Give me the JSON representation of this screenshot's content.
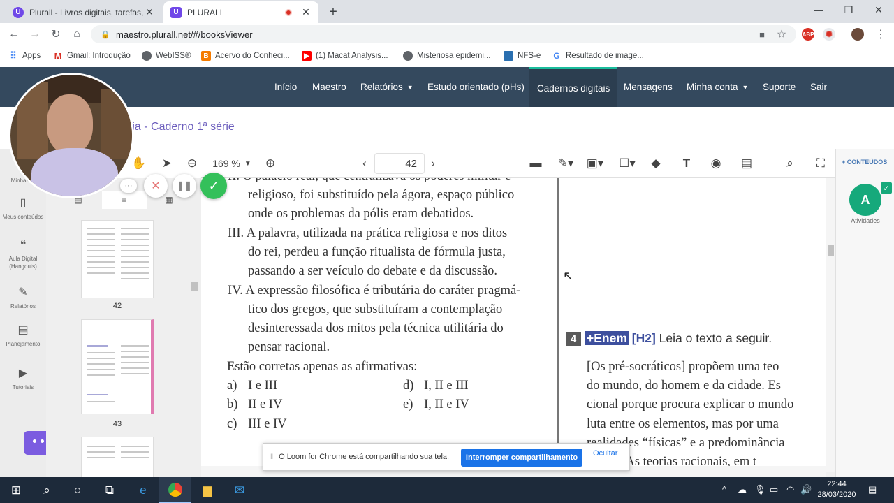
{
  "browser": {
    "tabs": [
      {
        "title": "Plurall - Livros digitais, tarefas, tu",
        "favicon": "U"
      },
      {
        "title": "PLURALL",
        "favicon": "U",
        "recording": true
      }
    ],
    "url": "maestro.plurall.net/#/booksViewer",
    "bookmarks": [
      {
        "label": "Apps"
      },
      {
        "label": "Gmail: Introdução"
      },
      {
        "label": "WebISS®"
      },
      {
        "label": "Acervo do Conheci..."
      },
      {
        "label": "(1) Macat Analysis..."
      },
      {
        "label": "Misteriosa epidemi..."
      },
      {
        "label": "NFS-e"
      },
      {
        "label": "Resultado de image..."
      }
    ]
  },
  "app_nav": {
    "items": [
      "Início",
      "Maestro",
      "Relatórios",
      "Estudo orientado (pHs)",
      "Cadernos digitais",
      "Mensagens",
      "Minha conta",
      "Suporte",
      "Sair"
    ],
    "current": "Cadernos digitais"
  },
  "book": {
    "title": "ofia - Caderno 1ª série"
  },
  "left_sidebar": {
    "items": [
      {
        "label": "Minhas tu",
        "icon": "tasks-icon"
      },
      {
        "label": "Meus conteúdos",
        "icon": "book-icon"
      },
      {
        "label": "Aula Digital (Hangouts)",
        "icon": "hangouts-icon"
      },
      {
        "label": "Relatórios",
        "icon": "report-icon"
      },
      {
        "label": "Planejamento",
        "icon": "clipboard-icon"
      },
      {
        "label": "Tutoriais",
        "icon": "play-icon"
      }
    ]
  },
  "thumbnails": [
    {
      "page": "42"
    },
    {
      "page": "43"
    }
  ],
  "viewer": {
    "zoom": "169 %",
    "page": "42"
  },
  "document": {
    "left_lines": [
      "II. O palácio real, que centralizava os poderes militar e",
      "religioso, foi substituído pela ágora, espaço público",
      "onde os problemas da pólis eram debatidos.",
      "III. A palavra, utilizada na prática religiosa e nos ditos",
      "do rei, perdeu a função ritualista de fórmula justa,",
      "passando a ser veículo do debate e da discussão.",
      "IV. A expressão filosófica é tributária do caráter pragmá-",
      "tico dos gregos, que substituíram a contemplação",
      "desinteressada dos mitos pela técnica utilitária do",
      "pensar racional."
    ],
    "prompt": "Estão corretas apenas as afirmativas:",
    "options": [
      {
        "letter": "a)",
        "text": "I e III"
      },
      {
        "letter": "b)",
        "text": "II e IV"
      },
      {
        "letter": "c)",
        "text": "III e IV"
      },
      {
        "letter": "d)",
        "text": "I, II e III"
      },
      {
        "letter": "e)",
        "text": "I, II e IV"
      }
    ],
    "question": {
      "number": "4",
      "tag": "+Enem",
      "skill": "[H2]",
      "instruction": "Leia o texto a seguir."
    },
    "right_lines": [
      "[Os pré-socráticos] propõem uma teo",
      "do mundo, do homem e da cidade. Es",
      "cional porque procura explicar o mundo",
      "luta entre os elementos, mas por uma",
      "realidades “físicas” e a predominância",
      "ns. [...] As teorias racionais, em t"
    ]
  },
  "right_panel": {
    "conteudos": "+ CONTEÚDOS",
    "activity_letter": "A",
    "activity_label": "Atividades"
  },
  "loom": {
    "message": "O Loom for Chrome está compartilhando sua tela.",
    "stop": "Interromper compartilhamento",
    "hide": "Ocultar"
  },
  "taskbar": {
    "time": "22:44",
    "date": "28/03/2020"
  },
  "colors": {
    "nav_bg": "#34495e",
    "accent_green": "#16a97b",
    "title_purple": "#6c5ebd",
    "loom_blue": "#1a73e8"
  }
}
